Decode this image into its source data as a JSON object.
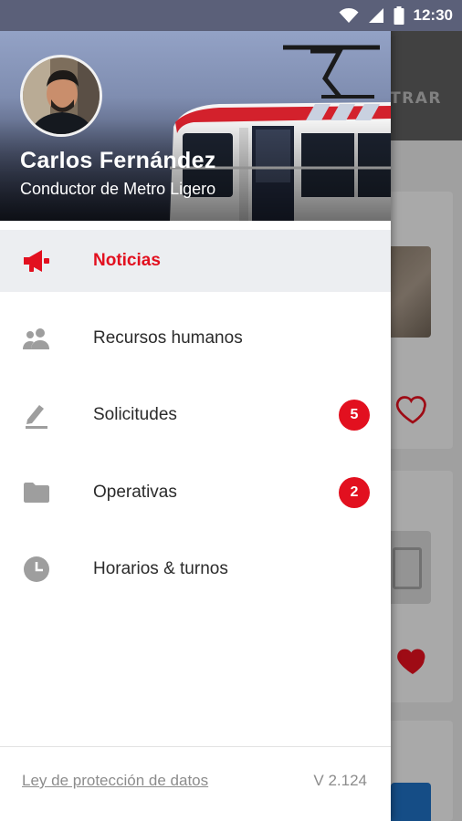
{
  "status_bar": {
    "time": "12:30"
  },
  "background": {
    "toolbar_action": "TRAR"
  },
  "drawer": {
    "user": {
      "name": "Carlos Fernández",
      "role": "Conductor de Metro Ligero"
    },
    "menu": [
      {
        "label": "Noticias",
        "icon": "megaphone-icon",
        "active": true
      },
      {
        "label": "Recursos humanos",
        "icon": "people-icon"
      },
      {
        "label": "Solicitudes",
        "icon": "edit-icon",
        "badge": "5"
      },
      {
        "label": "Operativas",
        "icon": "folder-icon",
        "badge": "2"
      },
      {
        "label": "Horarios & turnos",
        "icon": "clock-icon"
      }
    ],
    "footer": {
      "link": "Ley de protección de datos",
      "version": "V 2.124"
    }
  },
  "colors": {
    "accent": "#e2101f",
    "statusbar": "#5b6079",
    "icon_gray": "#9e9e9e"
  }
}
